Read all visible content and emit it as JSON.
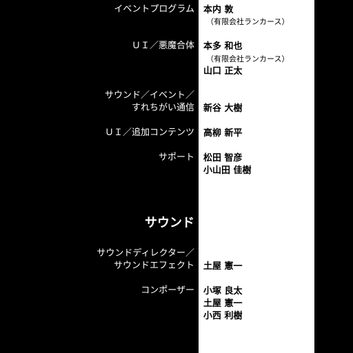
{
  "credits": {
    "event_programming": {
      "role": "イベントプログラム",
      "name_1": "本内 敦",
      "company_1": "（有限会社ランカース）"
    },
    "ui_demon_fusion": {
      "role": "ＵＩ／悪魔合体",
      "name_1": "本多 和也",
      "company_1": "（有限会社ランカース）",
      "name_2": "山口 正太"
    },
    "sound_event_streetpass": {
      "role_line_1": "サウンド／イベント／",
      "role_line_2": "すれちがい通信",
      "name_1": "新谷 大樹"
    },
    "ui_additional_content": {
      "role": "ＵＩ／追加コンテンツ",
      "name_1": "高柳 新平"
    },
    "support": {
      "role": "サポート",
      "name_1": "松田 智彦",
      "name_2": "小山田 佳樹"
    },
    "sound_section": {
      "header": "サウンド"
    },
    "sound_director_effects": {
      "role_line_1": "サウンドディレクター／",
      "role_line_2": "サウンドエフェクト",
      "name_1": "土屋 憲一"
    },
    "composer": {
      "role": "コンポーザー",
      "name_1": "小塚 良太",
      "name_2": "土屋 憲一",
      "name_3": "小西 利樹"
    }
  },
  "colors": {
    "background": "#000000",
    "name_panel": "#ffffff",
    "role_text": "#ffffff",
    "name_text": "#000000"
  }
}
